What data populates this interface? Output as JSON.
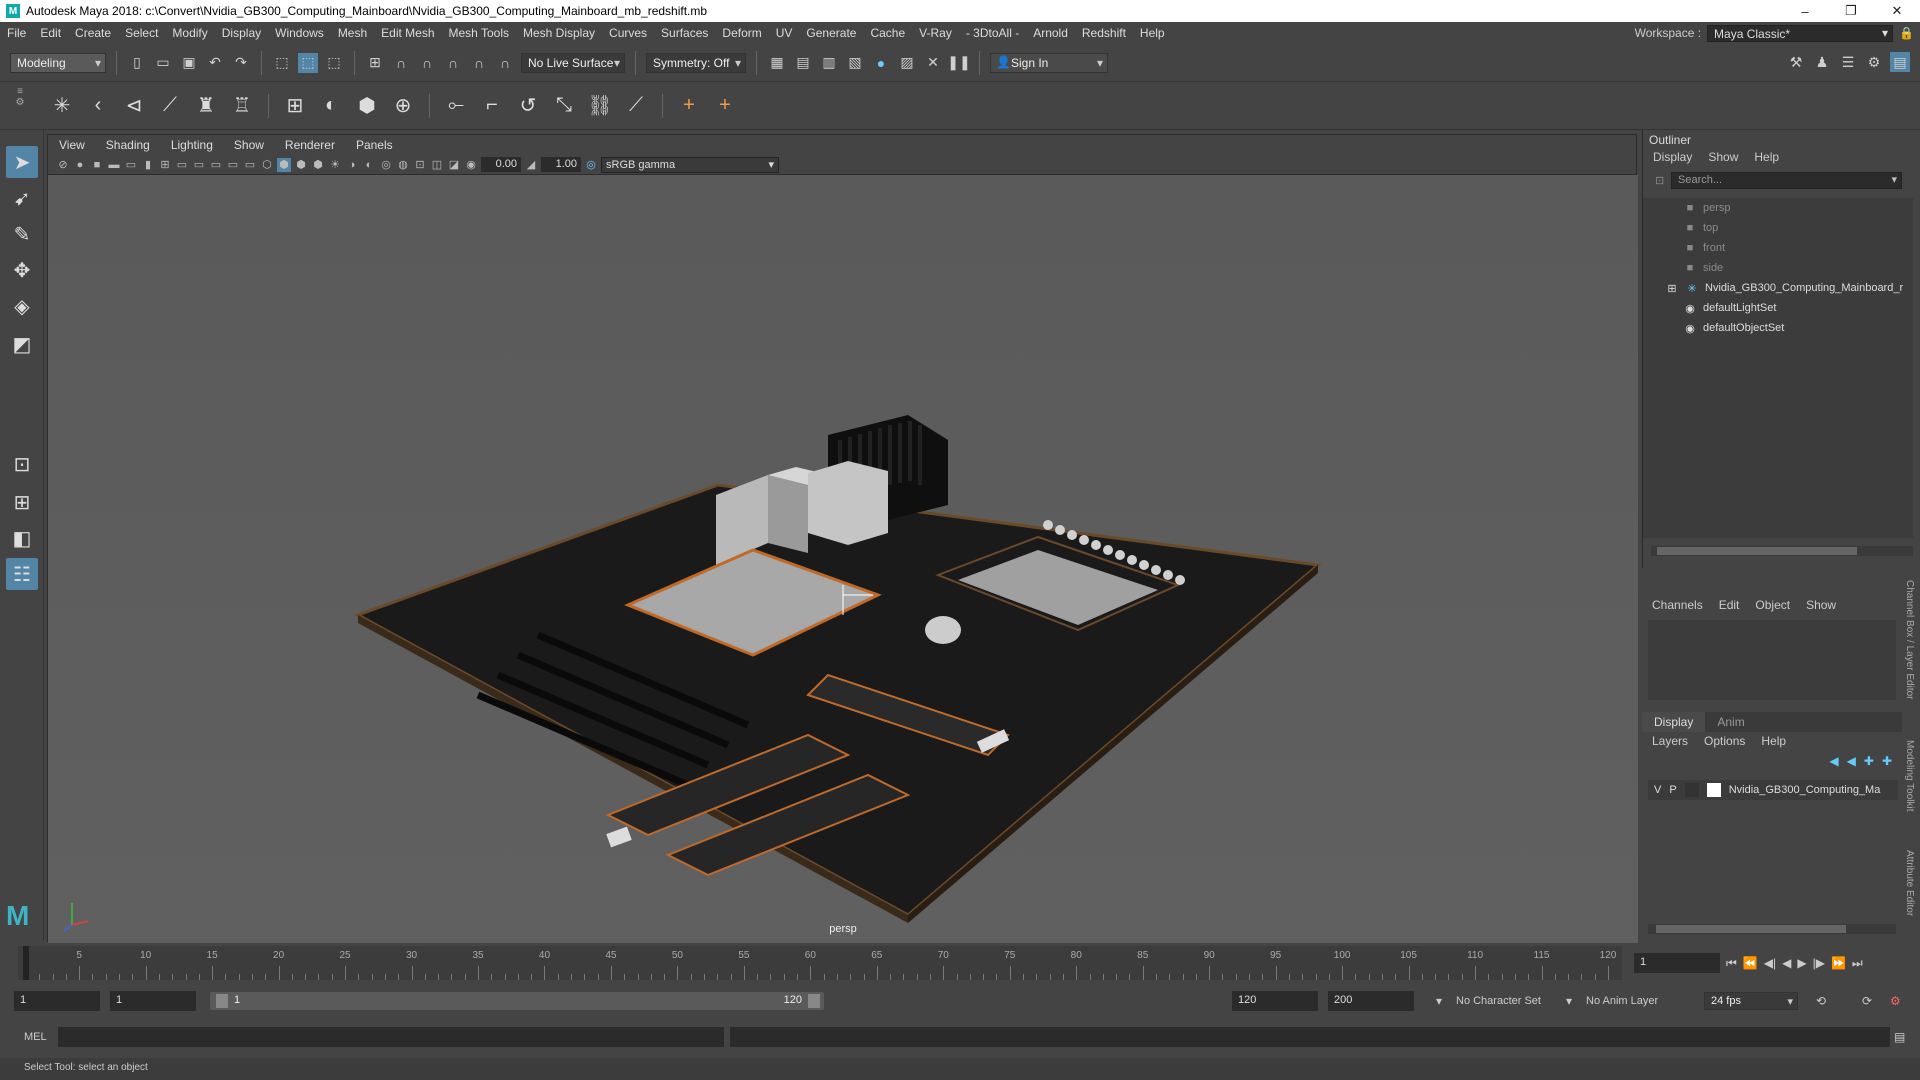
{
  "window": {
    "title": "Autodesk Maya 2018: c:\\Convert\\Nvidia_GB300_Computing_Mainboard\\Nvidia_GB300_Computing_Mainboard_mb_redshift.mb"
  },
  "menu": [
    "File",
    "Edit",
    "Create",
    "Select",
    "Modify",
    "Display",
    "Windows",
    "Mesh",
    "Edit Mesh",
    "Mesh Tools",
    "Mesh Display",
    "Curves",
    "Surfaces",
    "Deform",
    "UV",
    "Generate",
    "Cache",
    "V-Ray",
    "- 3DtoAll -",
    "Arnold",
    "Redshift",
    "Help"
  ],
  "workspace": {
    "label": "Workspace :",
    "value": "Maya Classic*"
  },
  "status": {
    "mode": "Modeling",
    "live_surface": "No Live Surface",
    "symmetry": "Symmetry: Off",
    "sign_in": "Sign In"
  },
  "viewport": {
    "menu": [
      "View",
      "Shading",
      "Lighting",
      "Show",
      "Renderer",
      "Panels"
    ],
    "exposure": "0.00",
    "gamma": "1.00",
    "color_space": "sRGB gamma",
    "camera": "persp"
  },
  "outliner": {
    "title": "Outliner",
    "menu": [
      "Display",
      "Show",
      "Help"
    ],
    "search_placeholder": "Search...",
    "items": [
      {
        "label": "persp",
        "icon": "camera-icon",
        "dim": true
      },
      {
        "label": "top",
        "icon": "camera-icon",
        "dim": true
      },
      {
        "label": "front",
        "icon": "camera-icon",
        "dim": true
      },
      {
        "label": "side",
        "icon": "camera-icon",
        "dim": true
      },
      {
        "label": "Nvidia_GB300_Computing_Mainboard_r",
        "icon": "group-icon",
        "dim": false
      },
      {
        "label": "defaultLightSet",
        "icon": "set-icon",
        "dim": false
      },
      {
        "label": "defaultObjectSet",
        "icon": "set-icon",
        "dim": false
      }
    ]
  },
  "channel_box": {
    "menu": [
      "Channels",
      "Edit",
      "Object",
      "Show"
    ]
  },
  "layer_editor": {
    "tabs": [
      "Display",
      "Anim"
    ],
    "menu": [
      "Layers",
      "Options",
      "Help"
    ],
    "layer": {
      "v": "V",
      "p": "P",
      "name": "Nvidia_GB300_Computing_Ma"
    }
  },
  "side_tabs": [
    "Channel Box / Layer Editor",
    "Modeling Toolkit",
    "Attribute Editor"
  ],
  "timeline": {
    "labels": [
      "1",
      "5",
      "10",
      "15",
      "20",
      "25",
      "30",
      "35",
      "40",
      "45",
      "50",
      "55",
      "60",
      "65",
      "70",
      "75",
      "80",
      "85",
      "90",
      "95",
      "100",
      "105",
      "110",
      "115",
      "120"
    ],
    "current": "1"
  },
  "range": {
    "start": "1",
    "start_inner": "1",
    "slider_start": "1",
    "slider_end": "120",
    "end_inner": "120",
    "end": "200",
    "char_set": "No Character Set",
    "anim_layer": "No Anim Layer",
    "fps": "24 fps"
  },
  "command": {
    "label": "MEL"
  },
  "help_line": "Select Tool: select an object"
}
